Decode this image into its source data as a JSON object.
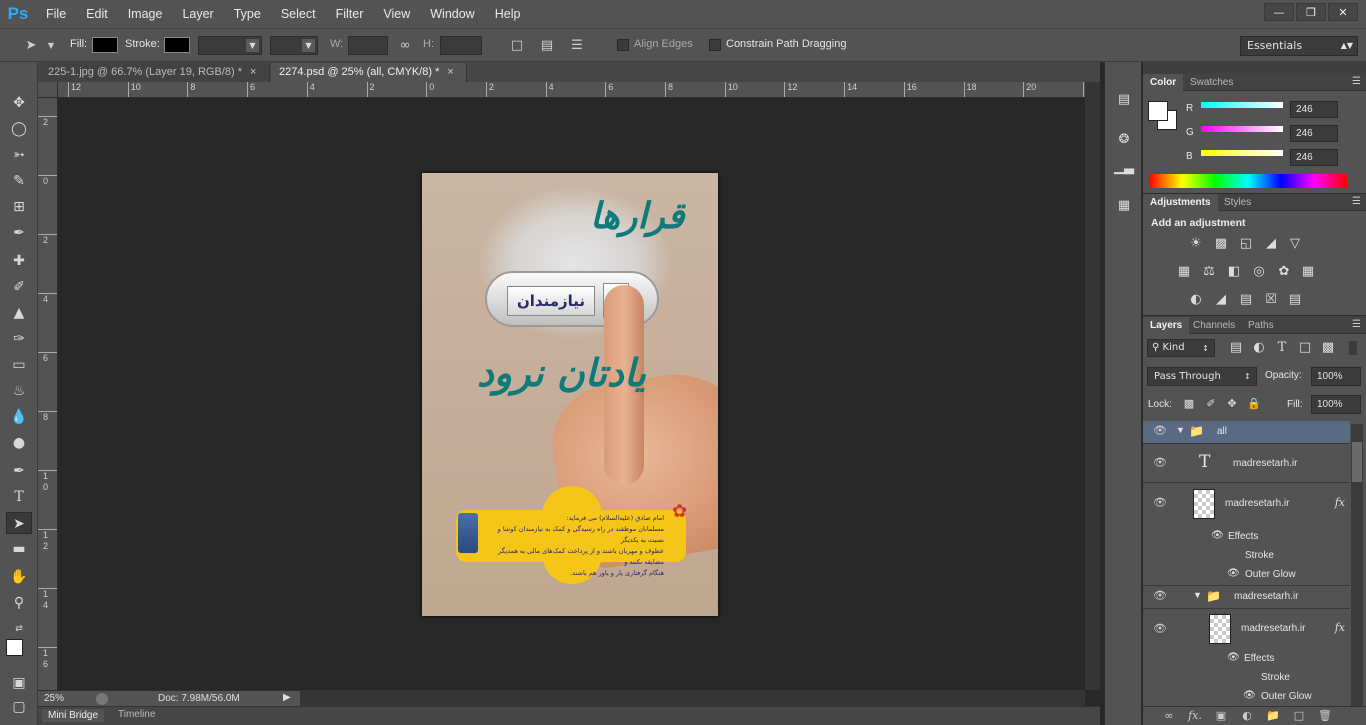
{
  "app": {
    "logo": "Ps",
    "menu": [
      "File",
      "Edit",
      "Image",
      "Layer",
      "Type",
      "Select",
      "Filter",
      "View",
      "Window",
      "Help"
    ],
    "window_controls": [
      "minimize-icon",
      "restore-icon",
      "close-icon"
    ]
  },
  "options_bar": {
    "fill_label": "Fill:",
    "stroke_label": "Stroke:",
    "w_label": "W:",
    "h_label": "H:",
    "align_edges": "Align Edges",
    "constrain": "Constrain Path Dragging",
    "workspace": "Essentials"
  },
  "tabs": [
    {
      "label": "225-1.jpg @ 66.7% (Layer 19, RGB/8) *",
      "active": false
    },
    {
      "label": "2274.psd @ 25% (all, CMYK/8) *",
      "active": true
    }
  ],
  "rulers": {
    "h_ticks": [
      "12",
      "10",
      "8",
      "6",
      "4",
      "2",
      "0",
      "2",
      "4",
      "6",
      "8",
      "10",
      "12",
      "14",
      "16",
      "18",
      "20",
      "22"
    ],
    "v_ticks": [
      "2",
      "0",
      "2",
      "4",
      "6",
      "8",
      "1\n0",
      "1\n2",
      "1\n4",
      "1\n6"
    ]
  },
  "document": {
    "title_top": "قرارها",
    "switch_label": "نیازمندان",
    "title_bottom": "یادتان نرود",
    "banner_lines": [
      "امام صادق (علیه‌السلام) می فرماید:",
      "مسلمانان موظفند در راه رسیدگی و کمک به نیازمندان کوشا و نسبت به یکدیگر",
      "عطوف و مهربان باشند و از پرداخت کمک‌های مالی به همدیگر مضایقه نکنند و",
      "هنگام گرفتاری یار و یاور هم باشند."
    ]
  },
  "status": {
    "zoom": "25%",
    "doc": "Doc: 7.98M/56.0M"
  },
  "bottom_tabs": [
    "Mini Bridge",
    "Timeline"
  ],
  "color_panel": {
    "tabs": [
      "Color",
      "Swatches"
    ],
    "channels": [
      {
        "label": "R",
        "value": "246",
        "color": "#00d8ff"
      },
      {
        "label": "G",
        "value": "246",
        "color": "#ff00ff"
      },
      {
        "label": "B",
        "value": "246",
        "color": "#ffff00"
      }
    ]
  },
  "adjustments_panel": {
    "tabs": [
      "Adjustments",
      "Styles"
    ],
    "heading": "Add an adjustment"
  },
  "layers_panel": {
    "tabs": [
      "Layers",
      "Channels",
      "Paths"
    ],
    "kind": "Kind",
    "blend_mode": "Pass Through",
    "opacity_label": "Opacity:",
    "opacity": "100%",
    "lock_label": "Lock:",
    "fill_label": "Fill:",
    "fill": "100%",
    "layers": [
      {
        "name": "all",
        "type": "group"
      },
      {
        "name": "madresetarh.ir",
        "type": "text"
      },
      {
        "name": "madresetarh.ir",
        "type": "pixel",
        "fx": "fx"
      },
      {
        "name": "Effects",
        "type": "effects"
      },
      {
        "name": "Stroke",
        "type": "effect"
      },
      {
        "name": "Outer Glow",
        "type": "effect"
      },
      {
        "name": "madresetarh.ir",
        "type": "group"
      },
      {
        "name": "madresetarh.ir",
        "type": "pixel",
        "fx": "fx"
      },
      {
        "name": "Effects",
        "type": "effects"
      },
      {
        "name": "Stroke",
        "type": "effect"
      },
      {
        "name": "Outer Glow",
        "type": "effect"
      }
    ]
  }
}
